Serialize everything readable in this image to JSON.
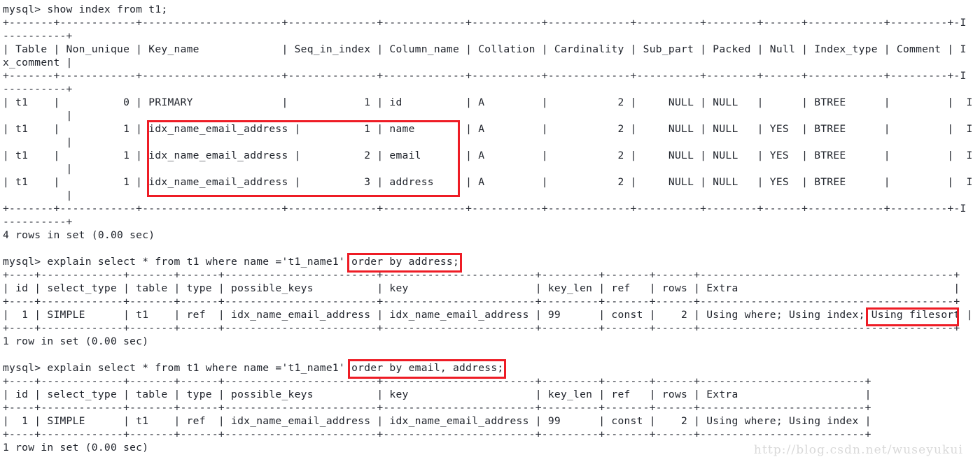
{
  "terminal": {
    "prompt": "mysql>",
    "watermark": "http://blog.csdn.net/wuseyukui",
    "lines": [
      "mysql> show index from t1;",
      "+-------+------------+----------------------+--------------+-------------+-----------+-------------+----------+--------+------+------------+---------+-I",
      "----------+",
      "| Table | Non_unique | Key_name             | Seq_in_index | Column_name | Collation | Cardinality | Sub_part | Packed | Null | Index_type | Comment | I",
      "x_comment |",
      "+-------+------------+----------------------+--------------+-------------+-----------+-------------+----------+--------+------+------------+---------+-I",
      "----------+",
      "| t1    |          0 | PRIMARY              |            1 | id          | A         |           2 |     NULL | NULL   |      | BTREE      |         |  I",
      "          |",
      "| t1    |          1 | idx_name_email_address |          1 | name        | A         |           2 |     NULL | NULL   | YES  | BTREE      |         |  I",
      "          |",
      "| t1    |          1 | idx_name_email_address |          2 | email       | A         |           2 |     NULL | NULL   | YES  | BTREE      |         |  I",
      "          |",
      "| t1    |          1 | idx_name_email_address |          3 | address     | A         |           2 |     NULL | NULL   | YES  | BTREE      |         |  I",
      "          |",
      "+-------+------------+----------------------+--------------+-------------+-----------+-------------+----------+--------+------+------------+---------+-I",
      "----------+",
      "4 rows in set (0.00 sec)",
      "",
      "mysql> explain select * from t1 where name ='t1_name1' order by address;",
      "+----+-------------+-------+------+------------------------+------------------------+---------+-------+------+----------------------------------------+",
      "| id | select_type | table | type | possible_keys          | key                    | key_len | ref   | rows | Extra                                  |",
      "+----+-------------+-------+------+------------------------+------------------------+---------+-------+------+----------------------------------------+",
      "|  1 | SIMPLE      | t1    | ref  | idx_name_email_address | idx_name_email_address | 99      | const |    2 | Using where; Using index; Using filesort |",
      "+----+-------------+-------+------+------------------------+------------------------+---------+-------+------+----------------------------------------+",
      "1 row in set (0.00 sec)",
      "",
      "mysql> explain select * from t1 where name ='t1_name1' order by email, address;",
      "+----+-------------+-------+------+------------------------+------------------------+---------+-------+------+--------------------------+",
      "| id | select_type | table | type | possible_keys          | key                    | key_len | ref   | rows | Extra                    |",
      "+----+-------------+-------+------+------------------------+------------------------+---------+-------+------+--------------------------+",
      "|  1 | SIMPLE      | t1    | ref  | idx_name_email_address | idx_name_email_address | 99      | const |    2 | Using where; Using index |",
      "+----+-------------+-------+------+------------------------+------------------------+---------+-------+------+--------------------------+",
      "1 row in set (0.00 sec)"
    ]
  },
  "commands": [
    {
      "text": "show index from t1;",
      "full": "mysql> show index from t1;"
    },
    {
      "text": "explain select * from t1 where name ='t1_name1' order by address;",
      "full": "mysql> explain select * from t1 where name ='t1_name1' order by address;"
    },
    {
      "text": "explain select * from t1 where name ='t1_name1' order by email, address;",
      "full": "mysql> explain select * from t1 where name ='t1_name1' order by email, address;"
    }
  ],
  "index_table": {
    "caption": "show index from t1;",
    "columns": [
      "Table",
      "Non_unique",
      "Key_name",
      "Seq_in_index",
      "Column_name",
      "Collation",
      "Cardinality",
      "Sub_part",
      "Packed",
      "Null",
      "Index_type",
      "Comment",
      "Index_comment"
    ],
    "rows": [
      [
        "t1",
        "0",
        "PRIMARY",
        "1",
        "id",
        "A",
        "2",
        "NULL",
        "NULL",
        "",
        "BTREE",
        "",
        ""
      ],
      [
        "t1",
        "1",
        "idx_name_email_address",
        "1",
        "name",
        "A",
        "2",
        "NULL",
        "NULL",
        "YES",
        "BTREE",
        "",
        ""
      ],
      [
        "t1",
        "1",
        "idx_name_email_address",
        "2",
        "email",
        "A",
        "2",
        "NULL",
        "NULL",
        "YES",
        "BTREE",
        "",
        ""
      ],
      [
        "t1",
        "1",
        "idx_name_email_address",
        "3",
        "address",
        "A",
        "2",
        "NULL",
        "NULL",
        "YES",
        "BTREE",
        "",
        ""
      ]
    ],
    "footer": "4 rows in set (0.00 sec)"
  },
  "explain_1": {
    "columns": [
      "id",
      "select_type",
      "table",
      "type",
      "possible_keys",
      "key",
      "key_len",
      "ref",
      "rows",
      "Extra"
    ],
    "rows": [
      [
        "1",
        "SIMPLE",
        "t1",
        "ref",
        "idx_name_email_address",
        "idx_name_email_address",
        "99",
        "const",
        "2",
        "Using where; Using index; Using filesort"
      ]
    ],
    "footer": "1 row in set (0.00 sec)"
  },
  "explain_2": {
    "columns": [
      "id",
      "select_type",
      "table",
      "type",
      "possible_keys",
      "key",
      "key_len",
      "ref",
      "rows",
      "Extra"
    ],
    "rows": [
      [
        "1",
        "SIMPLE",
        "t1",
        "ref",
        "idx_name_email_address",
        "idx_name_email_address",
        "99",
        "const",
        "2",
        "Using where; Using index"
      ]
    ],
    "footer": "1 row in set (0.00 sec)"
  },
  "highlights": [
    {
      "label": "idx_name_email_address index rows",
      "color": "#ee1c25"
    },
    {
      "label": "order by address;",
      "color": "#ee1c25"
    },
    {
      "label": "Using filesort",
      "color": "#ee1c25"
    },
    {
      "label": "order by email, address;",
      "color": "#ee1c25"
    }
  ]
}
